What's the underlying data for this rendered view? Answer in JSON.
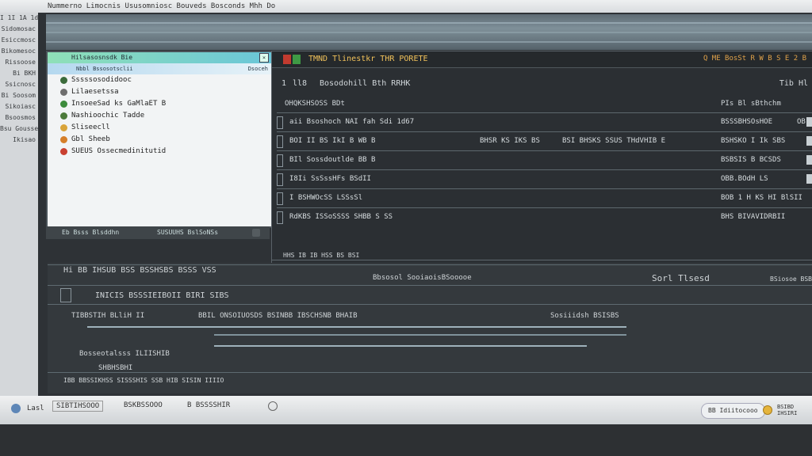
{
  "topbar": {
    "title": "Nummerno Limocnis Ususomniosc Bouveds Bosconds Mhh Do"
  },
  "sidebar": {
    "items": [
      "I 1I 1A 1ds",
      "Sidomosac",
      "Esiccmosc",
      "Bikomesoc",
      "Rissoose",
      "Bi BKH",
      "Ssicnosc",
      "Bi Soosom",
      "Sikoiasc",
      "Bsoosmos",
      "Bsu Gousse",
      "Ikisao"
    ]
  },
  "list": {
    "header": "Hilsasosnsdk Bie",
    "sub_left": "Nbbl Bssosotsclii",
    "sub_right": "Dsoceh",
    "items": [
      {
        "label": "Sssssosodidooc",
        "color": "#3b6b3b"
      },
      {
        "label": "Lilaesetssa",
        "color": "#6e6e6e"
      },
      {
        "label": "InsoeeSad ks  GaMlaET  B",
        "color": "#3c8b3c"
      },
      {
        "label": "Nashioochic  Tadde",
        "color": "#4c7a3a"
      },
      {
        "label": "Sliseecll",
        "color": "#d9a43a"
      },
      {
        "label": "Gbl Sheeb",
        "color": "#d57f2a"
      },
      {
        "label": "SUEUS Ossecmedinitutid",
        "color": "#c94030"
      }
    ],
    "footer_left": "Eb Bsss Blsddhn",
    "footer_mid": "SUSUUHS BslSoNSs"
  },
  "main": {
    "title": "TMND  Tlinestkr THR PORETE",
    "title_right": "Q  ME  BosSt  R  W  B  S  E  2  B",
    "sub_num": "1",
    "sub_hash": "ll8",
    "sub_label": "Bosodohill Bth RRHK",
    "sub_right": "Tib  Hl",
    "col_left": "OHQKSHSOSS BDt",
    "col_right": "PIs Bl sBthchm",
    "rows": [
      {
        "a": "aii  Bsoshoch NAI fah    Sdi 1d67",
        "b": "",
        "c": "",
        "d": "BSSSBHSOsHOE",
        "e": "OB"
      },
      {
        "a": "BOI II BS IkI B  WB  B",
        "b": "BHSR KS IKS BS",
        "c": "BSI BHSKS  SSUS  THdVHIB   E",
        "d": "BSHSKO  I  Ik  SBS",
        "e": ""
      },
      {
        "a": "BIl  Sossdoutlde  BB  B",
        "b": "",
        "c": "",
        "d": "BSBSIS  B  BCSDS",
        "e": ""
      },
      {
        "a": "I8Ii  SsSssHFs  BSdII",
        "b": "",
        "c": "",
        "d": "OBB.BOdH  LS",
        "e": ""
      },
      {
        "a": "I   BSHWOcSS   LSSsSl",
        "b": "",
        "c": "",
        "d": "BOB  1 H KS HI BlSII",
        "e": ""
      },
      {
        "a": "RdKBS   ISSoSSSS  SHBB  S SS",
        "b": "",
        "c": "",
        "d": "BHS  BIVAVIDRBII",
        "e": ""
      }
    ],
    "footer": "HHS  IB  IB  HSS  BS  BSI"
  },
  "lower": {
    "row1_left": "Hi  BB  IHSUB BSS  BSSHSBS  BSSS  VSS",
    "row1_mid": "Bbsosol      SooiaoisBSooooe",
    "row1_right": "Sorl Tlsesd",
    "row1_far": "BSiosoe  BSB",
    "row2": "INICIS  BSSSIEIBOII BIRI SIBS",
    "row3_left": "TIBBSTIH  BLliH  II",
    "row3_mid": "BBIL ONSOIUOSDS  BSINBB IBSCHSNB  BHAIB",
    "row3_right": "Sosiiidsh  BSISBS",
    "row4": "Bosseotalsss ILIISHIB",
    "row5": "SHBHSBHI",
    "row6": "IBB  BBSSIKHSS  SISSSHIS SSB  HIB  SISIN  IIIIO"
  },
  "taskbar": {
    "item1": "Lasl",
    "item2": "SIBTIHSOOO",
    "item3": "BSKBSSOOO",
    "item4": "B BSSSSHIR",
    "tray1": "BB  Idiitocooo",
    "tray2": "BSIBD  IHSIRI"
  }
}
